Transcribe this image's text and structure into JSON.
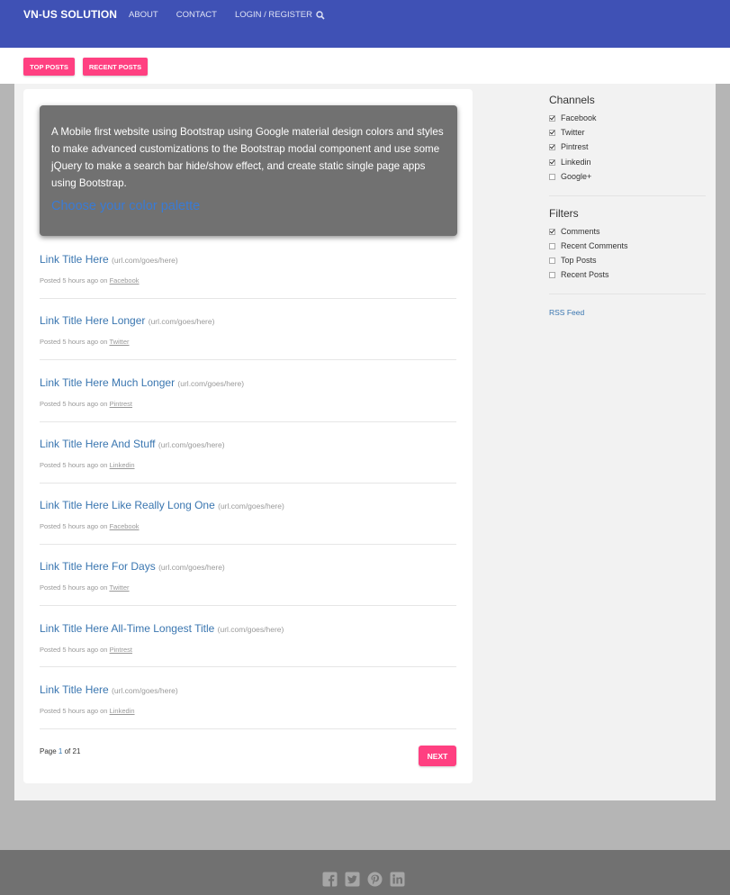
{
  "navbar": {
    "brand": "VN-US SOLUTION",
    "links": [
      "ABOUT",
      "CONTACT",
      "LOGIN / REGISTER"
    ],
    "search_icon": "search-icon"
  },
  "subbar": {
    "top_posts": "TOP POSTS",
    "recent_posts": "RECENT POSTS"
  },
  "hero": {
    "text": "A Mobile first website using Bootstrap using Google material design colors and styles to make advanced customizations to the Bootstrap modal component and use some jQuery to make a search bar hide/show effect, and create static single page apps using Bootstrap.",
    "link": "Choose your color palette"
  },
  "posts": [
    {
      "title": "Link Title Here",
      "url": "(url.com/goes/here)",
      "meta": "Posted 5 hours ago on",
      "source": "Facebook"
    },
    {
      "title": "Link Title Here Longer",
      "url": "(url.com/goes/here)",
      "meta": "Posted 5 hours ago on",
      "source": "Twitter"
    },
    {
      "title": "Link Title Here Much Longer",
      "url": "(url.com/goes/here)",
      "meta": "Posted 5 hours ago on",
      "source": "Pintrest"
    },
    {
      "title": "Link Title Here And Stuff",
      "url": "(url.com/goes/here)",
      "meta": "Posted 5 hours ago on",
      "source": "Linkedin"
    },
    {
      "title": "Link Title Here Like Really Long One",
      "url": "(url.com/goes/here)",
      "meta": "Posted 5 hours ago on",
      "source": "Facebook"
    },
    {
      "title": "Link Title Here For Days",
      "url": "(url.com/goes/here)",
      "meta": "Posted 5 hours ago on",
      "source": "Twitter"
    },
    {
      "title": "Link Title Here All-Time Longest Title",
      "url": "(url.com/goes/here)",
      "meta": "Posted 5 hours ago on",
      "source": "Pintrest"
    },
    {
      "title": "Link Title Here",
      "url": "(url.com/goes/here)",
      "meta": "Posted 5 hours ago on",
      "source": "Linkedin"
    }
  ],
  "pager": {
    "prefix": "Page",
    "current": "1",
    "of": "of 21",
    "next": "NEXT"
  },
  "sidebar": {
    "channels_heading": "Channels",
    "channels": [
      {
        "label": "Facebook",
        "checked": true
      },
      {
        "label": "Twitter",
        "checked": true
      },
      {
        "label": "Pintrest",
        "checked": true
      },
      {
        "label": "Linkedin",
        "checked": true
      },
      {
        "label": "Google+",
        "checked": false
      }
    ],
    "filters_heading": "Filters",
    "filters": [
      {
        "label": "Comments",
        "checked": true
      },
      {
        "label": "Recent Comments",
        "checked": false
      },
      {
        "label": "Top Posts",
        "checked": false
      },
      {
        "label": "Recent Posts",
        "checked": false
      }
    ],
    "rss": "RSS Feed"
  },
  "footer": {
    "icons": [
      "facebook-icon",
      "twitter-icon",
      "pinterest-icon",
      "linkedin-icon"
    ]
  },
  "colors": {
    "primary": "#3f51b5",
    "accent": "#ff4081",
    "link": "#3a76b0",
    "footer": "#717171"
  }
}
